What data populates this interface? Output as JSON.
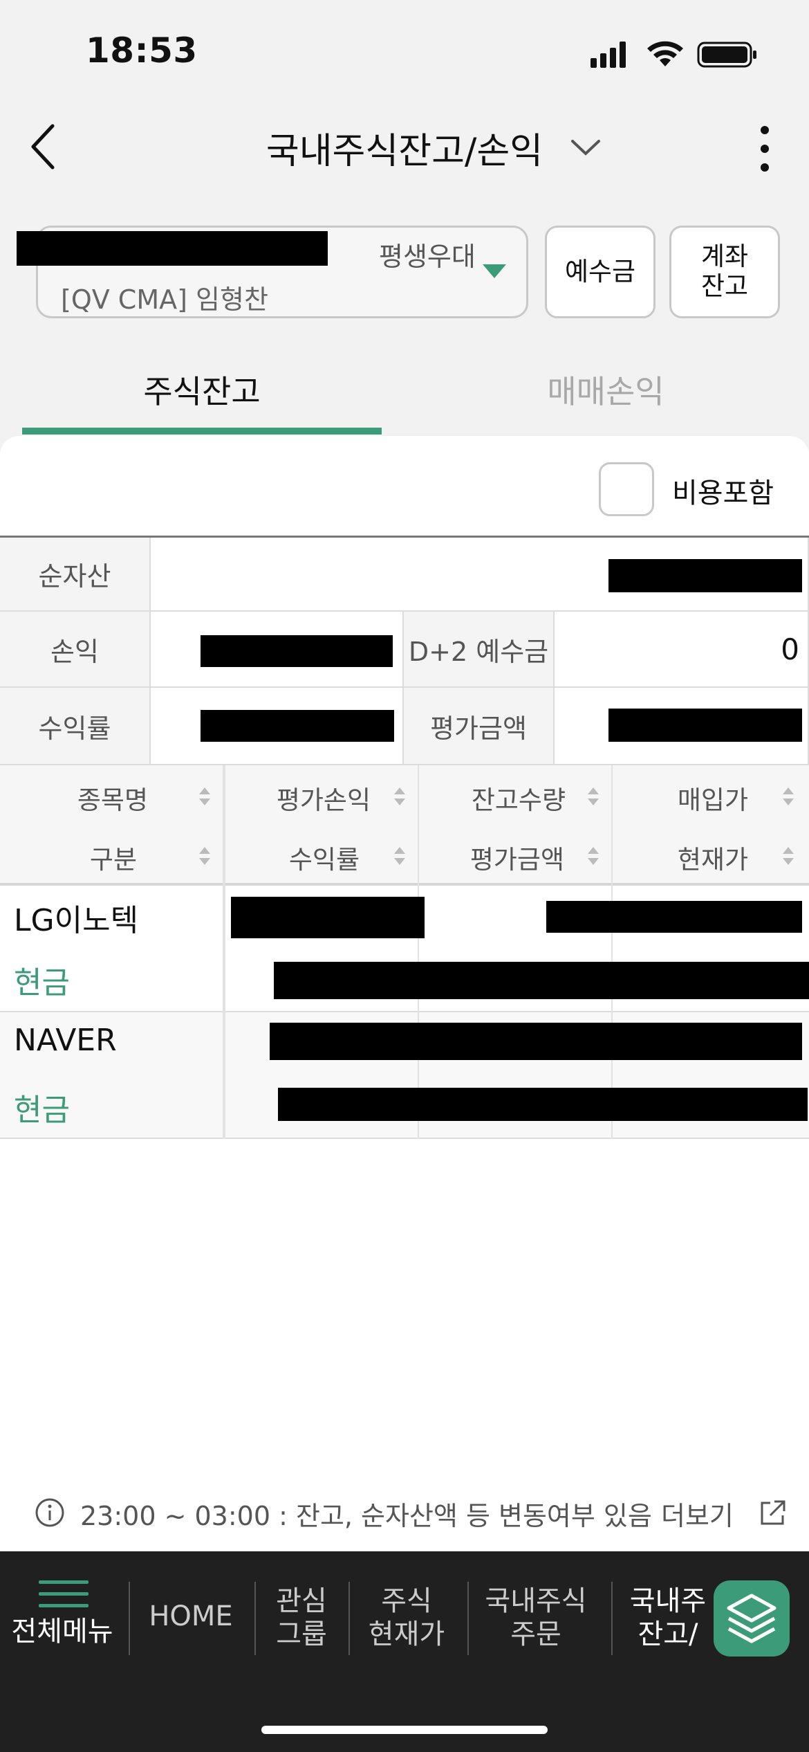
{
  "status_bar": {
    "time": "18:53"
  },
  "header": {
    "title": "국내주식잔고/손익"
  },
  "account": {
    "nickname": "평생우대",
    "number_label": "[QV CMA]  임형찬",
    "deposit_button": "예수금",
    "balance_button_line1": "계좌",
    "balance_button_line2": "잔고"
  },
  "tabs": [
    {
      "label": "주식잔고",
      "active": true
    },
    {
      "label": "매매손익",
      "active": false
    }
  ],
  "fee_option": {
    "label": "비용포함",
    "checked": false
  },
  "summary": {
    "net_assets_label": "순자산",
    "pnl_label": "손익",
    "d2_deposit_label": "D+2 예수금",
    "d2_deposit_value": "0",
    "return_rate_label": "수익률",
    "eval_amount_label": "평가금액"
  },
  "holdings": {
    "columns_row1": [
      "종목명",
      "평가손익",
      "잔고수량",
      "매입가"
    ],
    "columns_row2": [
      "구분",
      "수익률",
      "평가금액",
      "현재가"
    ],
    "rows": [
      {
        "name": "LG이노텍",
        "type": "현금"
      },
      {
        "name": "NAVER",
        "type": "현금"
      }
    ]
  },
  "notice": {
    "text": "23:00 ~ 03:00 : 잔고, 순자산액 등 변동여부 있음",
    "more": "더보기"
  },
  "bottom_nav": {
    "menu_label": "전체메뉴",
    "items": [
      {
        "line1": "HOME",
        "line2": ""
      },
      {
        "line1": "관심",
        "line2": "그룹"
      },
      {
        "line1": "주식",
        "line2": "현재가"
      },
      {
        "line1": "국내주식",
        "line2": "주문"
      },
      {
        "line1": "국내주",
        "line2": "잔고/"
      }
    ]
  },
  "colors": {
    "accent": "#3c9c7a",
    "nav_bg": "#202020",
    "page_bg": "#f2f2f2"
  },
  "icons": [
    "back-icon",
    "chevron-down-icon",
    "more-vert-icon",
    "info-icon",
    "external-link-icon",
    "menu-icon",
    "layers-icon"
  ]
}
